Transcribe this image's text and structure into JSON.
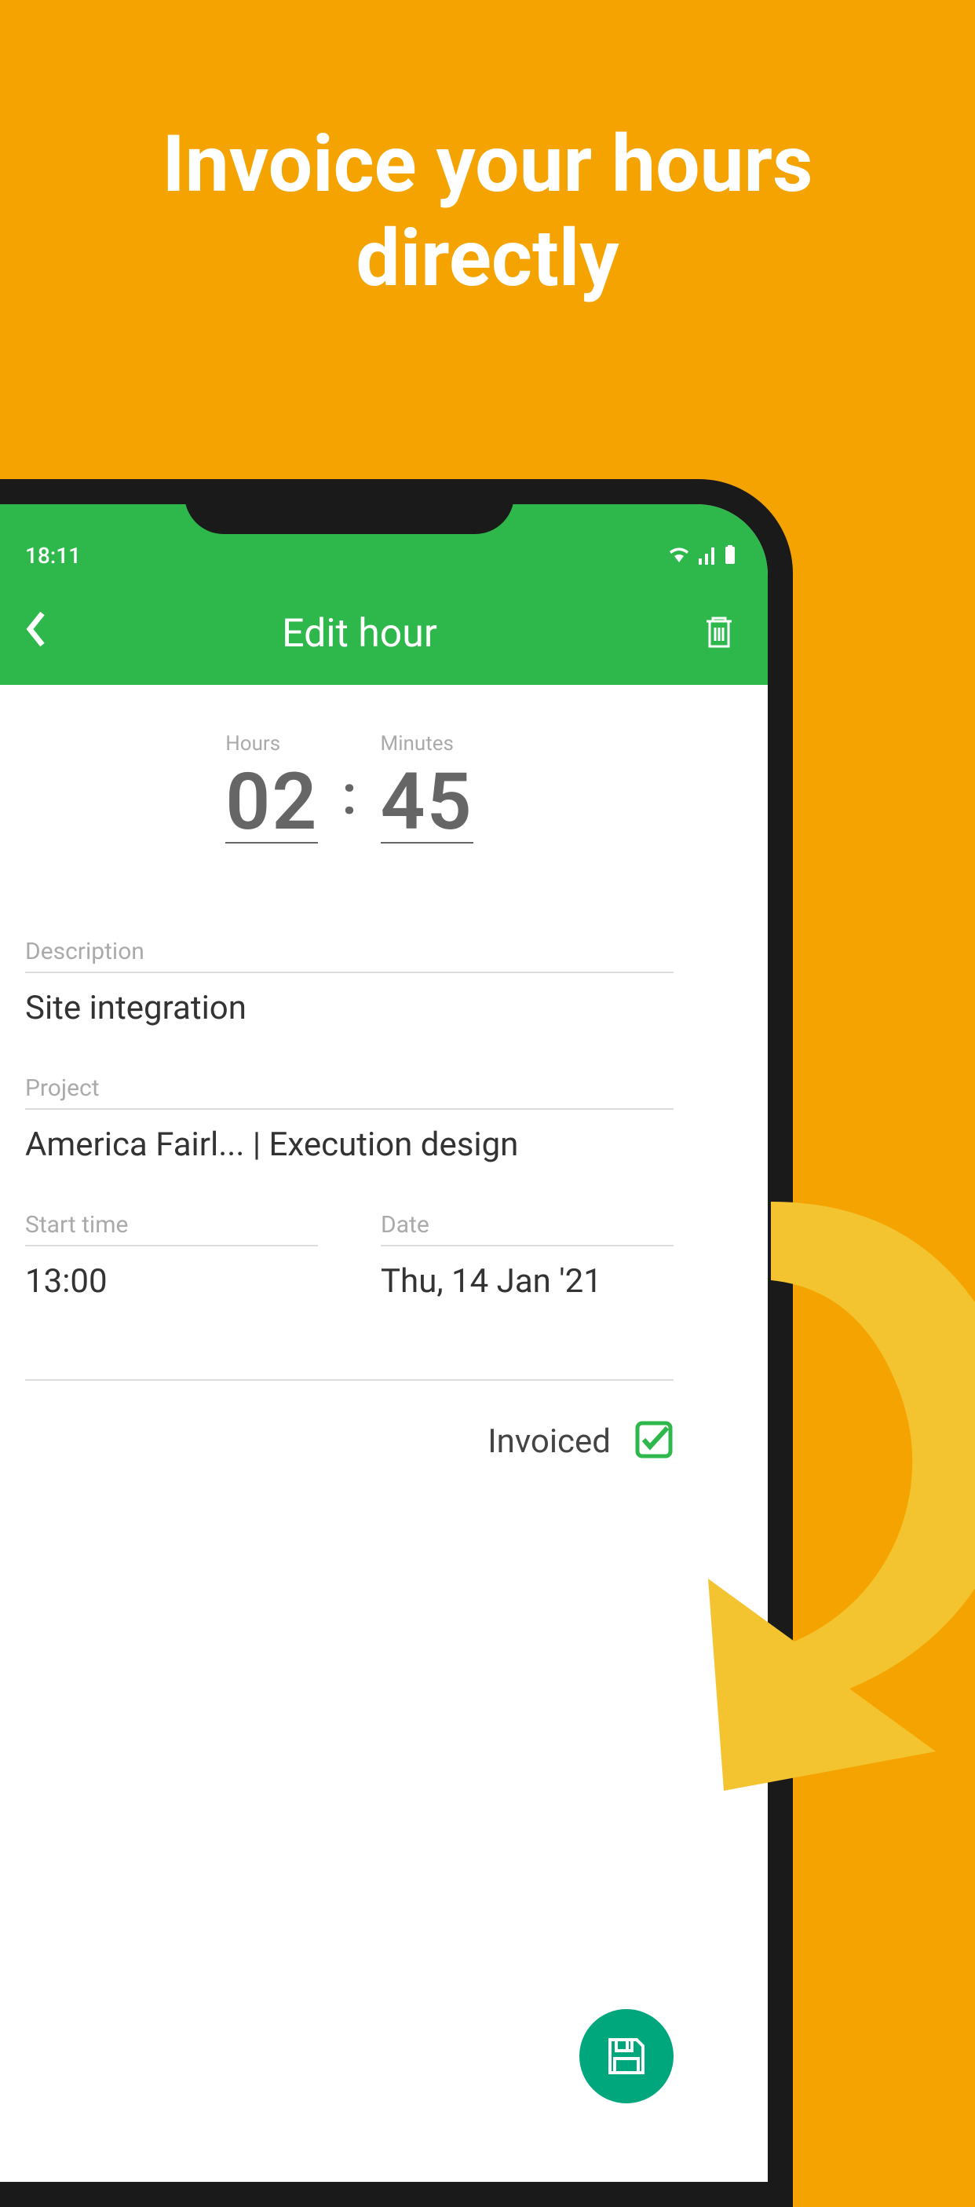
{
  "promo": {
    "title": "Invoice your hours\ndirectly"
  },
  "status": {
    "time": "18:11"
  },
  "header": {
    "title": "Edit hour"
  },
  "time": {
    "hours_label": "Hours",
    "hours_value": "02",
    "separator": ":",
    "minutes_label": "Minutes",
    "minutes_value": "45"
  },
  "fields": {
    "description_label": "Description",
    "description_value": "Site integration",
    "project_label": "Project",
    "project_value": "America Fairl... | Execution design",
    "start_time_label": "Start time",
    "start_time_value": "13:00",
    "date_label": "Date",
    "date_value": "Thu, 14 Jan '21"
  },
  "invoiced": {
    "label": "Invoiced"
  }
}
